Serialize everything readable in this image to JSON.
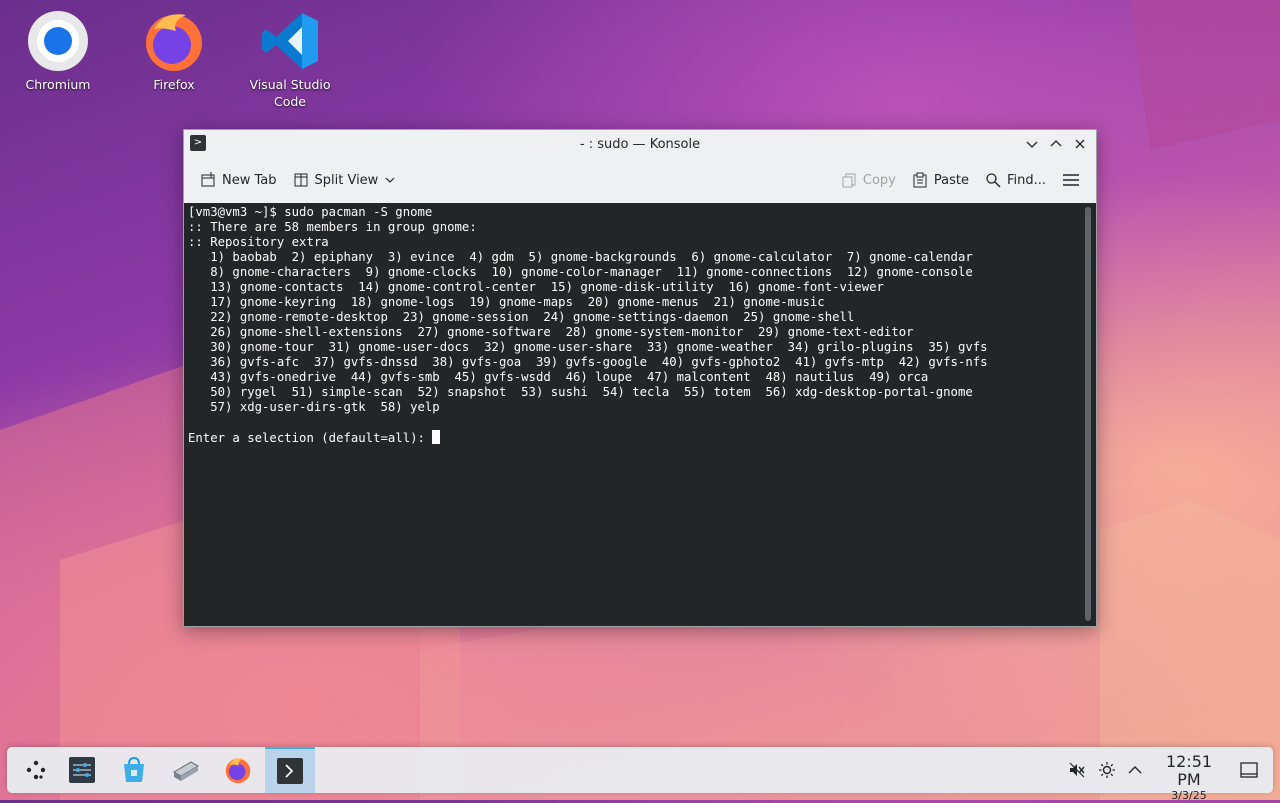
{
  "desktop": {
    "icons": [
      {
        "label": "Chromium",
        "icon": "chromium-icon"
      },
      {
        "label": "Firefox",
        "icon": "firefox-icon"
      },
      {
        "label": "Visual Studio Code",
        "icon": "vscode-icon"
      }
    ]
  },
  "window": {
    "title": "- : sudo — Konsole",
    "toolbar": {
      "new_tab": "New Tab",
      "split_view": "Split View",
      "copy": "Copy",
      "paste": "Paste",
      "find": "Find..."
    },
    "terminal": {
      "lines": [
        "[vm3@vm3 ~]$ sudo pacman -S gnome",
        ":: There are 58 members in group gnome:",
        ":: Repository extra",
        "   1) baobab  2) epiphany  3) evince  4) gdm  5) gnome-backgrounds  6) gnome-calculator  7) gnome-calendar",
        "   8) gnome-characters  9) gnome-clocks  10) gnome-color-manager  11) gnome-connections  12) gnome-console",
        "   13) gnome-contacts  14) gnome-control-center  15) gnome-disk-utility  16) gnome-font-viewer",
        "   17) gnome-keyring  18) gnome-logs  19) gnome-maps  20) gnome-menus  21) gnome-music",
        "   22) gnome-remote-desktop  23) gnome-session  24) gnome-settings-daemon  25) gnome-shell",
        "   26) gnome-shell-extensions  27) gnome-software  28) gnome-system-monitor  29) gnome-text-editor",
        "   30) gnome-tour  31) gnome-user-docs  32) gnome-user-share  33) gnome-weather  34) grilo-plugins  35) gvfs",
        "   36) gvfs-afc  37) gvfs-dnssd  38) gvfs-goa  39) gvfs-google  40) gvfs-gphoto2  41) gvfs-mtp  42) gvfs-nfs",
        "   43) gvfs-onedrive  44) gvfs-smb  45) gvfs-wsdd  46) loupe  47) malcontent  48) nautilus  49) orca",
        "   50) rygel  51) simple-scan  52) snapshot  53) sushi  54) tecla  55) totem  56) xdg-desktop-portal-gnome",
        "   57) xdg-user-dirs-gtk  58) yelp",
        ""
      ],
      "prompt": "Enter a selection (default=all): "
    }
  },
  "taskbar": {
    "items": [
      "app-launcher-icon",
      "system-settings-icon",
      "discover-icon",
      "scanner-icon",
      "firefox-icon",
      "konsole-icon"
    ],
    "active_item": "konsole-icon",
    "tray": [
      "volume-muted-icon",
      "brightness-icon",
      "tray-expand-icon"
    ],
    "time": "12:51 PM",
    "date": "3/3/25"
  }
}
